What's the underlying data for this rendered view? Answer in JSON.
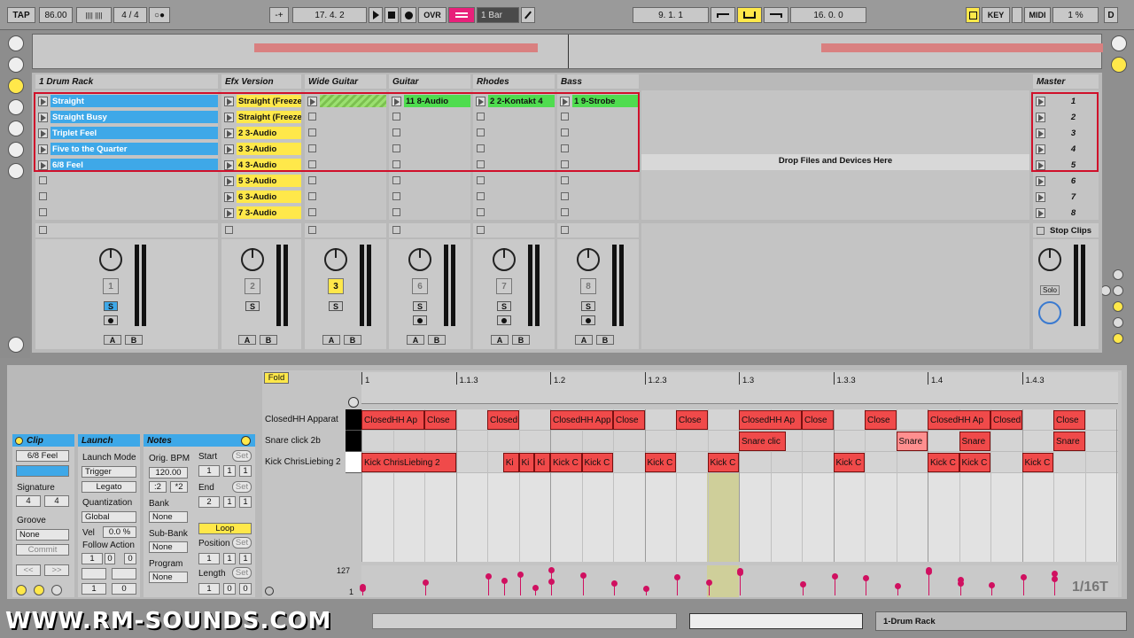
{
  "transport": {
    "tap": "TAP",
    "bpm": "86.00",
    "meter_icons": "||||  ||||",
    "signature": "4  /  4",
    "metro": "○●",
    "follow": "-+",
    "position": "17.   4.   2",
    "ovr": "OVR",
    "quant": "1 Bar",
    "loop_start": "9.   1.   1",
    "loop_len": "16.   0.   0",
    "key": "KEY",
    "midi": "MIDI",
    "cpu": "1 %",
    "d": "D"
  },
  "tracks": [
    {
      "name": "1 Drum Rack",
      "clips": [
        "Straight",
        "Straight Busy",
        "Triplet Feel",
        "Five to the Quarter",
        "6/8 Feel",
        "",
        "",
        ""
      ],
      "number": "1",
      "color": "#3ea8e8"
    },
    {
      "name": "Efx Version",
      "clips": [
        "Straight (Freeze",
        "Straight (Freeze",
        "2 3-Audio",
        "3 3-Audio",
        "4 3-Audio",
        "5 3-Audio",
        "6 3-Audio",
        "7 3-Audio"
      ],
      "number": "2",
      "color": "#ffe84a"
    },
    {
      "name": "Wide Guitar",
      "clips": [
        "",
        "",
        "",
        "",
        "",
        "",
        "",
        ""
      ],
      "number": "3",
      "color": "#9be070"
    },
    {
      "name": "Guitar",
      "clips": [
        "11 8-Audio",
        "",
        "",
        "",
        "",
        "",
        "",
        ""
      ],
      "number": "6",
      "color": "#4fdc4f"
    },
    {
      "name": "Rhodes",
      "clips": [
        "2 2-Kontakt 4",
        "",
        "",
        "",
        "",
        "",
        "",
        ""
      ],
      "number": "7",
      "color": "#4fdc4f"
    },
    {
      "name": "Bass",
      "clips": [
        "1 9-Strobe",
        "",
        "",
        "",
        "",
        "",
        "",
        ""
      ],
      "number": "8",
      "color": "#4fdc4f"
    }
  ],
  "master": {
    "name": "Master",
    "scenes": [
      "1",
      "2",
      "3",
      "4",
      "5",
      "6",
      "7",
      "8"
    ],
    "stop_clips": "Stop Clips",
    "solo": "Solo"
  },
  "drop_text": "Drop Files and Devices Here",
  "mixer": {
    "s": "S",
    "a": "A",
    "b": "B"
  },
  "clip_view": {
    "clip_title": "Clip",
    "clip_name": "6/8 Feel",
    "signature_label": "Signature",
    "sig_num": "4",
    "sig_den": "4",
    "groove_label": "Groove",
    "groove_value": "None",
    "commit": "Commit",
    "nav_prev": "<<",
    "nav_next": ">>",
    "launch_title": "Launch",
    "launch_mode_label": "Launch Mode",
    "launch_mode": "Trigger",
    "legato": "Legato",
    "quant_label": "Quantization",
    "quant_value": "Global",
    "vel_label": "Vel",
    "vel_value": "0.0 %",
    "follow_label": "Follow Action",
    "fa1": "1",
    "fa2": "0",
    "fa3": "1",
    "fa4": "0",
    "notes_title": "Notes",
    "bpm_label": "Orig. BPM",
    "bpm_value": "120.00",
    "half": ":2",
    "double": "*2",
    "bank_label": "Bank",
    "bank_value": "None",
    "subbank_label": "Sub-Bank",
    "subbank_value": "None",
    "program_label": "Program",
    "program_value": "None",
    "start_label": "Start",
    "set": "Set",
    "start": [
      "1",
      "1",
      "1"
    ],
    "end_label": "End",
    "end": [
      "2",
      "1",
      "1"
    ],
    "loop": "Loop",
    "position_label": "Position",
    "pos": [
      "1",
      "1",
      "1"
    ],
    "length_label": "Length",
    "len": [
      "1",
      "0",
      "0"
    ]
  },
  "editor": {
    "fold": "Fold",
    "ruler": [
      "1",
      "1.1.3",
      "1.2",
      "1.2.3",
      "1.3",
      "1.3.3",
      "1.4",
      "1.4.3"
    ],
    "lanes": [
      "ClosedHH Apparat",
      "Snare click 2b",
      "Kick ChrisLiebing 2"
    ],
    "vel_max": "127",
    "vel_min": "1",
    "grid": "1/16T",
    "notes": [
      {
        "lane": 0,
        "start": 0,
        "len": 2,
        "label": "ClosedHH Ap"
      },
      {
        "lane": 0,
        "start": 2,
        "len": 1,
        "label": "Close"
      },
      {
        "lane": 0,
        "start": 4,
        "len": 1,
        "label": "Closed"
      },
      {
        "lane": 0,
        "start": 6,
        "len": 2,
        "label": "ClosedHH App"
      },
      {
        "lane": 0,
        "start": 8,
        "len": 1,
        "label": "Close"
      },
      {
        "lane": 0,
        "start": 10,
        "len": 1,
        "label": "Close"
      },
      {
        "lane": 0,
        "start": 12,
        "len": 2,
        "label": "ClosedHH Ap"
      },
      {
        "lane": 0,
        "start": 14,
        "len": 1,
        "label": "Close"
      },
      {
        "lane": 0,
        "start": 16,
        "len": 1,
        "label": "Close"
      },
      {
        "lane": 0,
        "start": 18,
        "len": 2,
        "label": "ClosedHH Ap"
      },
      {
        "lane": 0,
        "start": 20,
        "len": 1,
        "label": "Closed"
      },
      {
        "lane": 0,
        "start": 22,
        "len": 1,
        "label": "Close"
      },
      {
        "lane": 1,
        "start": 12,
        "len": 1.5,
        "label": "Snare clic"
      },
      {
        "lane": 1,
        "start": 17,
        "len": 1,
        "label": "Snare"
      },
      {
        "lane": 1,
        "start": 19,
        "len": 1,
        "label": "Snare"
      },
      {
        "lane": 1,
        "start": 22,
        "len": 1,
        "label": "Snare"
      },
      {
        "lane": 2,
        "start": 0,
        "len": 3,
        "label": "Kick ChrisLiebing 2"
      },
      {
        "lane": 2,
        "start": 4.5,
        "len": 0.5,
        "label": "Ki"
      },
      {
        "lane": 2,
        "start": 5,
        "len": 0.5,
        "label": "Ki"
      },
      {
        "lane": 2,
        "start": 5.5,
        "len": 0.5,
        "label": "Ki"
      },
      {
        "lane": 2,
        "start": 6,
        "len": 1,
        "label": "Kick C"
      },
      {
        "lane": 2,
        "start": 7,
        "len": 1,
        "label": "Kick C"
      },
      {
        "lane": 2,
        "start": 9,
        "len": 1,
        "label": "Kick C"
      },
      {
        "lane": 2,
        "start": 11,
        "len": 1,
        "label": "Kick C"
      },
      {
        "lane": 2,
        "start": 15,
        "len": 1,
        "label": "Kick C"
      },
      {
        "lane": 2,
        "start": 18,
        "len": 1,
        "label": "Kick C"
      },
      {
        "lane": 2,
        "start": 19,
        "len": 1,
        "label": "Kick C"
      },
      {
        "lane": 2,
        "start": 21,
        "len": 1,
        "label": "Kick C"
      }
    ]
  },
  "status": {
    "track": "1-Drum Rack",
    "watermark": "WWW.RM-SOUNDS.COM"
  }
}
